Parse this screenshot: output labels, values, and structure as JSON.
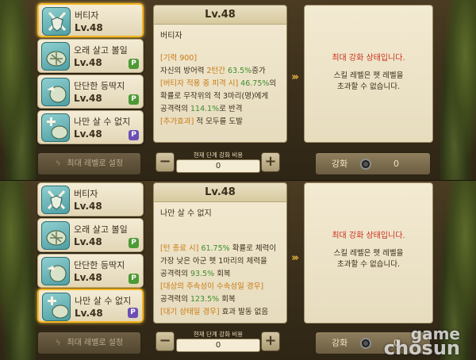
{
  "panels": [
    {
      "selected": 0,
      "skills": [
        {
          "name": "버티자",
          "level": "Lv.48",
          "badge": ""
        },
        {
          "name": "오래 살고 볼일",
          "level": "Lv.48",
          "badge": "P"
        },
        {
          "name": "단단한 등딱지",
          "level": "Lv.48",
          "badge": "P"
        },
        {
          "name": "나만 살 수 없지",
          "level": "Lv.48",
          "badge": "P"
        }
      ],
      "desc": {
        "level": "Lv.48",
        "title": "버티자",
        "lines": [
          {
            "parts": [
              {
                "t": "[기력 900]",
                "c": "o"
              }
            ]
          },
          {
            "parts": [
              {
                "t": "자신의 방어력 ",
                "c": ""
              },
              {
                "t": "2턴간 ",
                "c": "o"
              },
              {
                "t": "63.5%",
                "c": "g"
              },
              {
                "t": "증가",
                "c": ""
              }
            ]
          },
          {
            "parts": [
              {
                "t": "[버티자 적용 중 피격 시] ",
                "c": "o"
              },
              {
                "t": "46.75%",
                "c": "g"
              },
              {
                "t": "의",
                "c": ""
              }
            ]
          },
          {
            "parts": [
              {
                "t": "확률로 무작위의 적 3마리(명)에게",
                "c": ""
              }
            ]
          },
          {
            "parts": [
              {
                "t": "공격력의 ",
                "c": ""
              },
              {
                "t": "114.1%",
                "c": "g"
              },
              {
                "t": "로 반격",
                "c": ""
              }
            ]
          },
          {
            "parts": [
              {
                "t": "[추가효과]",
                "c": "o"
              },
              {
                "t": " 적 모두를 도발",
                "c": ""
              }
            ]
          }
        ]
      },
      "result": {
        "status": "최대 강화 상태입니다.",
        "message_line1": "스킬 레벨은 펫 레벨을",
        "message_line2": "초과할 수 없습니다."
      },
      "controls": {
        "max_level_label": "최대 레벨로 설정",
        "cost_caption": "현재 단계 강화 비용",
        "cost_value": "0",
        "minus": "−",
        "plus": "+",
        "enhance_label": "강화",
        "enhance_cost": "0"
      }
    },
    {
      "selected": 3,
      "skills": [
        {
          "name": "버티자",
          "level": "Lv.48",
          "badge": ""
        },
        {
          "name": "오래 살고 볼일",
          "level": "Lv.48",
          "badge": "P"
        },
        {
          "name": "단단한 등딱지",
          "level": "Lv.48",
          "badge": "P"
        },
        {
          "name": "나만 살 수 없지",
          "level": "Lv.48",
          "badge": "P"
        }
      ],
      "desc": {
        "level": "Lv.48",
        "title": "나만 살 수 없지",
        "lines": [
          {
            "parts": [
              {
                "t": "[턴 종료 시] ",
                "c": "o"
              },
              {
                "t": "61.75%",
                "c": "g"
              },
              {
                "t": " 확률로 체력이",
                "c": ""
              }
            ]
          },
          {
            "parts": [
              {
                "t": "가장 낮은 아군 펫 1마리의 체력을",
                "c": ""
              }
            ]
          },
          {
            "parts": [
              {
                "t": "공격력의 ",
                "c": ""
              },
              {
                "t": "93.5%",
                "c": "g"
              },
              {
                "t": " 회복",
                "c": ""
              }
            ]
          },
          {
            "parts": [
              {
                "t": "[대상의 주속성이 수속성일 경우]",
                "c": "o"
              }
            ]
          },
          {
            "parts": [
              {
                "t": "공격력의 ",
                "c": ""
              },
              {
                "t": "123.5%",
                "c": "g"
              },
              {
                "t": " 회복",
                "c": ""
              }
            ]
          },
          {
            "parts": [
              {
                "t": "[대기 상태일 경우]",
                "c": "o"
              },
              {
                "t": " 효과 발동 없음",
                "c": ""
              }
            ]
          }
        ]
      },
      "result": {
        "status": "최대 강화 상태입니다.",
        "message_line1": "스킬 레벨은 펫 레벨을",
        "message_line2": "초과할 수 없습니다."
      },
      "controls": {
        "max_level_label": "최대 레벨로 설정",
        "cost_caption": "현재 단계 강화 비용",
        "cost_value": "0",
        "minus": "−",
        "plus": "+",
        "enhance_label": "강화",
        "enhance_cost": "0"
      }
    }
  ],
  "watermark": {
    "line1": "game",
    "line2": "chosun"
  },
  "colors": {
    "highlight": "#f3b620",
    "value_green": "#3e8f2e",
    "tag_orange": "#c97a12",
    "status_red": "#c9311e",
    "passive_green": "#4c9a36",
    "passive_purple": "#6c4fb5"
  },
  "icons": [
    "shield-swords-icon",
    "turtle-shell-icon",
    "shield-arm-icon",
    "heal-cross-icon",
    "lightning-icon",
    "coin-icon"
  ]
}
